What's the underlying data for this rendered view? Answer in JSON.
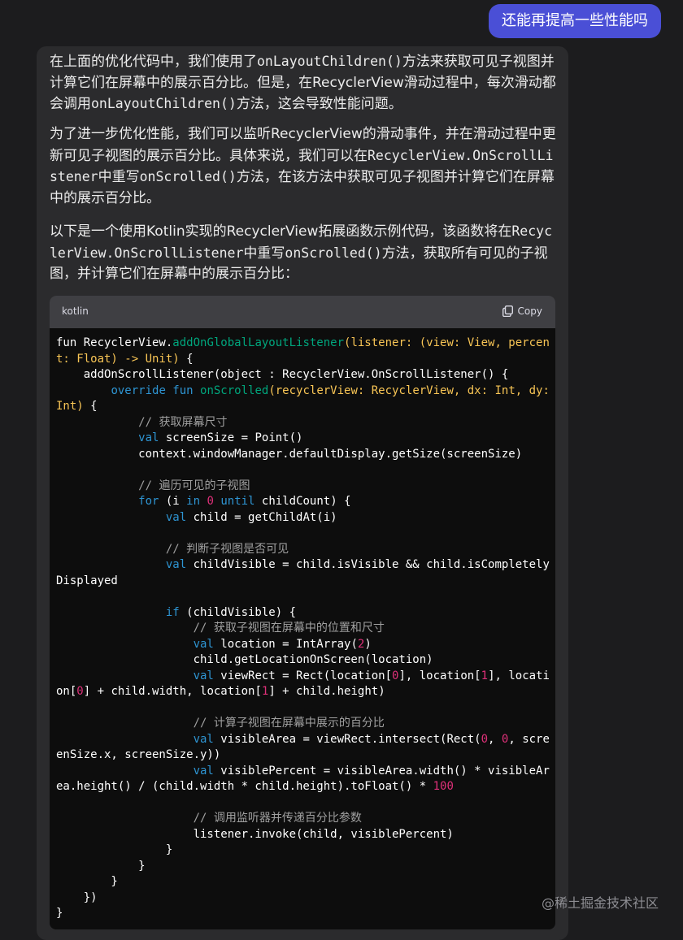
{
  "user_message": "还能再提高一些性能吗",
  "answer": {
    "p1": "在上面的优化代码中，我们使用了onLayoutChildren()方法来获取可见子视图并计算它们在屏幕中的展示百分比。但是，在RecyclerView滑动过程中，每次滑动都会调用onLayoutChildren()方法，这会导致性能问题。",
    "p2": "为了进一步优化性能，我们可以监听RecyclerView的滑动事件，并在滑动过程中更新可见子视图的展示百分比。具体来说，我们可以在RecyclerView.OnScrollListener中重写onScrolled()方法，在该方法中获取可见子视图并计算它们在屏幕中的展示百分比。",
    "p3": "以下是一个使用Kotlin实现的RecyclerView拓展函数示例代码，该函数将在RecyclerView.OnScrollListener中重写onScrolled()方法，获取所有可见的子视图，并计算它们在屏幕中的展示百分比："
  },
  "code_block": {
    "language": "kotlin",
    "copy_label": "Copy",
    "copy_icon": "clipboard-icon",
    "lines": [
      "fun RecyclerView.addOnGlobalLayoutListener(listener: (view: View, percen",
      "t: Float) -> Unit) {",
      "    addOnScrollListener(object : RecyclerView.OnScrollListener() {",
      "        override fun onScrolled(recyclerView: RecyclerView, dx: Int, dy:",
      "Int) {",
      "            // 获取屏幕尺寸",
      "            val screenSize = Point()",
      "            context.windowManager.defaultDisplay.getSize(screenSize)",
      "",
      "            // 遍历可见的子视图",
      "            for (i in 0 until childCount) {",
      "                val child = getChildAt(i)",
      "",
      "                // 判断子视图是否可见",
      "                val childVisible = child.isVisible && child.isCompletely",
      "Displayed",
      "",
      "                if (childVisible) {",
      "                    // 获取子视图在屏幕中的位置和尺寸",
      "                    val location = IntArray(2)",
      "                    child.getLocationOnScreen(location)",
      "                    val viewRect = Rect(location[0], location[1], locati",
      "on[0] + child.width, location[1] + child.height)",
      "",
      "                    // 计算子视图在屏幕中展示的百分比",
      "                    val visibleArea = viewRect.intersect(Rect(0, 0, scre",
      "enSize.x, screenSize.y))",
      "                    val visiblePercent = visibleArea.width() * visibleAr",
      "ea.height() / (child.width * child.height).toFloat() * 100",
      "",
      "                    // 调用监听器并传递百分比参数",
      "                    listener.invoke(child, visiblePercent)",
      "                }",
      "            }",
      "        }",
      "    })",
      "}"
    ]
  },
  "watermark": "@稀土掘金技术社区",
  "colors": {
    "background": "#1c1c1e",
    "user_bubble": "#4a4fd6",
    "answer_card": "#2b2b2d",
    "code_header": "#3f3f43",
    "code_background": "#0d0d0d"
  }
}
